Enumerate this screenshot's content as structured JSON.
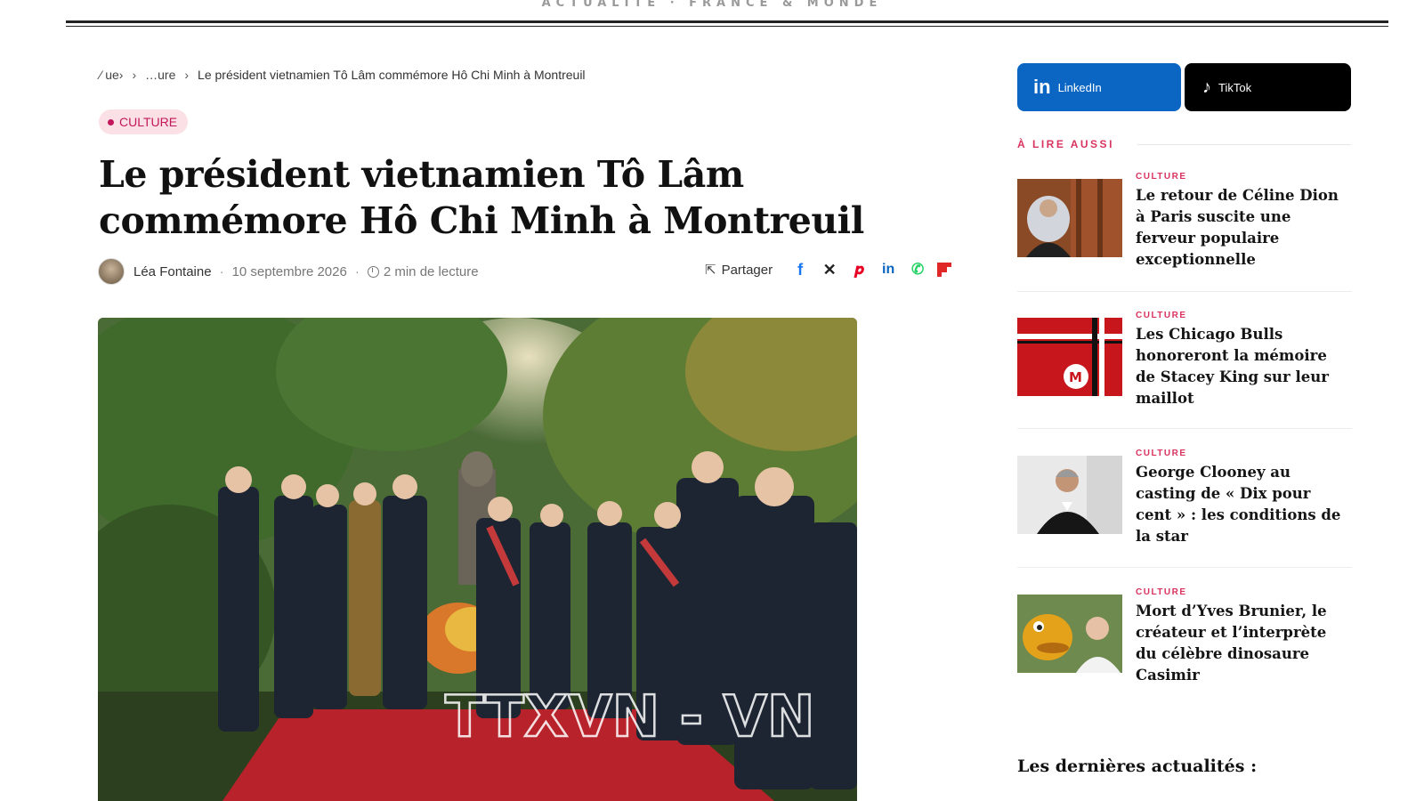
{
  "masthead": {
    "tagline": "ACTUALITÉ · FRANCE & MONDE"
  },
  "breadcrumb": {
    "items": [
      "⁄ ue›",
      "›",
      "…ure",
      "›",
      "Le président vietnamien Tô Lâm commémore Hô Chi Minh à Montreuil"
    ]
  },
  "article": {
    "category": "CULTURE",
    "title": "Le président vietnamien Tô Lâm commémore Hô Chi Minh à Montreuil",
    "author": "Léa Fontaine",
    "date": "10 septembre 2026",
    "read_time": "2 min de lecture",
    "share_label": "Partager",
    "share_icons": [
      "facebook-icon",
      "x-icon",
      "pinterest-icon",
      "linkedin-icon",
      "whatsapp-icon",
      "flipboard-icon"
    ],
    "image_watermark": "TTXVN - VN"
  },
  "sidebar": {
    "linkedin_label": "LinkedIn",
    "tiktok_label": "TikTok",
    "read_also_heading": "À LIRE AUSSI",
    "related": [
      {
        "category": "CULTURE",
        "title": "Le retour de Céline Dion à Paris suscite une ferveur populaire exceptionnelle"
      },
      {
        "category": "CULTURE",
        "title": "Les Chicago Bulls honoreront la mémoire de Stacey King sur leur maillot"
      },
      {
        "category": "CULTURE",
        "title": "George Clooney au casting de « Dix pour cent » : les conditions de la star"
      },
      {
        "category": "CULTURE",
        "title": "Mort d’Yves Brunier, le créateur et l’interprète du célèbre dinosaure Casimir"
      }
    ],
    "latest_heading": "Les dernières actualités :"
  },
  "colors": {
    "accent": "#d8345f",
    "linkedin": "#0a66c2",
    "tiktok": "#000000"
  }
}
